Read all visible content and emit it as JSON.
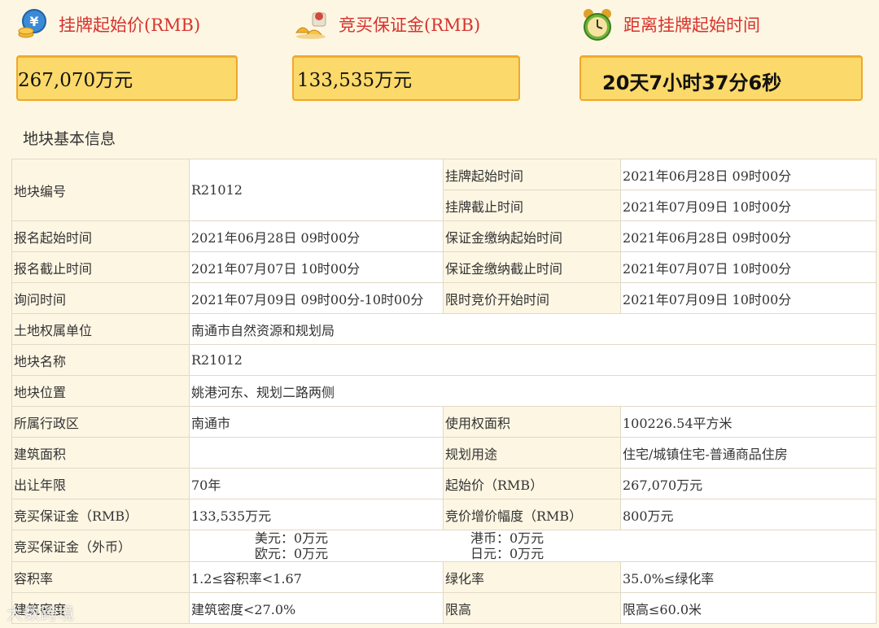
{
  "header": {
    "start_price_label": "挂牌起始价(RMB)",
    "start_price_value": "267,070万元",
    "deposit_label": "竞买保证金(RMB)",
    "deposit_value": "133,535万元",
    "countdown_label": "距离挂牌起始时间",
    "countdown_value": "20天7小时37分6秒"
  },
  "icons": {
    "start_price": "money-coins-icon",
    "deposit": "gold-ingots-icon",
    "countdown": "alarm-clock-icon"
  },
  "section_title": "地块基本信息",
  "table": {
    "parcel_no_label": "地块编号",
    "parcel_no": "R21012",
    "listing_start_label": "挂牌起始时间",
    "listing_start": "2021年06月28日 09时00分",
    "listing_end_label": "挂牌截止时间",
    "listing_end": "2021年07月09日 10时00分",
    "reg_start_label": "报名起始时间",
    "reg_start": "2021年06月28日 09时00分",
    "deposit_pay_start_label": "保证金缴纳起始时间",
    "deposit_pay_start": "2021年06月28日 09时00分",
    "reg_end_label": "报名截止时间",
    "reg_end": "2021年07月07日 10时00分",
    "deposit_pay_end_label": "保证金缴纳截止时间",
    "deposit_pay_end": "2021年07月07日 10时00分",
    "inquiry_label": "询问时间",
    "inquiry": "2021年07月09日 09时00分-10时00分",
    "timed_bid_label": "限时竞价开始时间",
    "timed_bid": "2021年07月09日 10时00分",
    "owner_label": "土地权属单位",
    "owner": "南通市自然资源和规划局",
    "name_label": "地块名称",
    "name": "R21012",
    "location_label": "地块位置",
    "location": "姚港河东、规划二路两侧",
    "district_label": "所属行政区",
    "district": "南通市",
    "use_area_label": "使用权面积",
    "use_area": "100226.54平方米",
    "build_area_label": "建筑面积",
    "build_area": "",
    "plan_use_label": "规划用途",
    "plan_use": "住宅/城镇住宅-普通商品住房",
    "term_label": "出让年限",
    "term": "70年",
    "start_price_label": "起始价（RMB）",
    "start_price": "267,070万元",
    "deposit_rmb_label": "竞买保证金（RMB）",
    "deposit_rmb": "133,535万元",
    "increment_label": "竞价增价幅度（RMB）",
    "increment": "800万元",
    "deposit_fx_label": "竞买保证金（外币）",
    "usd": "美元：0万元",
    "hkd": "港币：0万元",
    "eur": "欧元：0万元",
    "jpy": "日元：0万元",
    "far_label": "容积率",
    "far": "1.2≤容积率<1.67",
    "green_label": "绿化率",
    "green": "35.0%≤绿化率",
    "density_label": "建筑密度",
    "density": "建筑密度<27.0%",
    "height_label": "限高",
    "height": "限高≤60.0米"
  },
  "watermark": "大数跨境"
}
